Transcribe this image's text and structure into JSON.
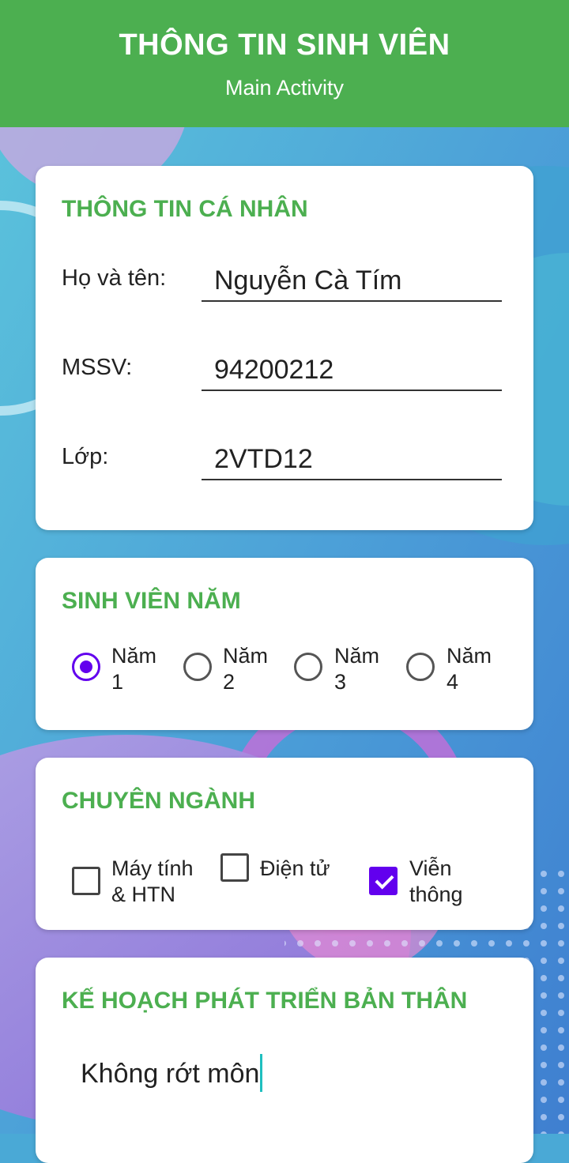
{
  "app": {
    "title": "THÔNG TIN SINH VIÊN",
    "subtitle": "Main Activity"
  },
  "personal": {
    "title": "THÔNG TIN CÁ NHÂN",
    "name_label": "Họ và tên:",
    "name_value": "Nguyễn Cà Tím",
    "mssv_label": "MSSV:",
    "mssv_value": "94200212",
    "class_label": "Lớp:",
    "class_value": "2VTD12"
  },
  "year": {
    "title": "SINH VIÊN NĂM",
    "options": [
      {
        "label": "Năm\n1",
        "checked": true
      },
      {
        "label": "Năm\n2",
        "checked": false
      },
      {
        "label": "Năm\n3",
        "checked": false
      },
      {
        "label": "Năm\n4",
        "checked": false
      }
    ]
  },
  "major": {
    "title": "CHUYÊN NGÀNH",
    "options": [
      {
        "label": "Máy tính\n& HTN",
        "checked": false
      },
      {
        "label": "Điện tử",
        "checked": false
      },
      {
        "label": "Viễn\nthông",
        "checked": true
      }
    ]
  },
  "plan": {
    "title": "KẾ HOẠCH PHÁT TRIỂN BẢN THÂN",
    "text": "Không rớt môn"
  },
  "colors": {
    "appbar": "#4caf50",
    "accent": "#6200ee",
    "caret": "#1fbfbf"
  }
}
